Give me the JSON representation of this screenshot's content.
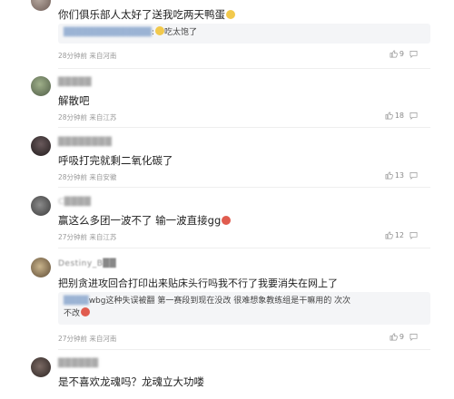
{
  "comments": [
    {
      "text": "你们俱乐部人太好了送我吃两天鸭蛋",
      "emoji_color": "#f2c94c",
      "reply": {
        "user": "██████████████",
        "text": "吃太饱了",
        "emoji_color": "#f2c94c"
      },
      "meta": "28分钟前 来自河南",
      "likes": "9"
    },
    {
      "user": "█████",
      "text": "解散吧",
      "meta": "28分钟前 来自江苏",
      "likes": "18"
    },
    {
      "user": "████████",
      "text": "呼吸打完就剩二氧化碳了",
      "meta": "28分钟前 来自安徽",
      "likes": "13"
    },
    {
      "user": "C████",
      "text": "赢这么多团一波不了 输一波直接gg",
      "emoji_color": "#e05c4f",
      "meta": "27分钟前 来自江苏",
      "likes": "12"
    },
    {
      "user": "Destiny_B██",
      "text": "把别贪进攻回合打印出来贴床头行吗我不行了我要消失在网上了",
      "reply": {
        "user": "████",
        "text_line1": "wbg这种失误被翻 第一赛段到现在没改 很难想象教练组是干嘛用的 次次",
        "text_line2": "不改",
        "emoji_color": "#e05c4f"
      },
      "meta": "27分钟前 来自河南",
      "likes": "9"
    },
    {
      "user": "██████",
      "text": "是不喜欢龙魂吗？龙魂立大功喽"
    }
  ],
  "icons": {
    "like": "thumbs-up-icon",
    "reply": "comment-icon"
  }
}
